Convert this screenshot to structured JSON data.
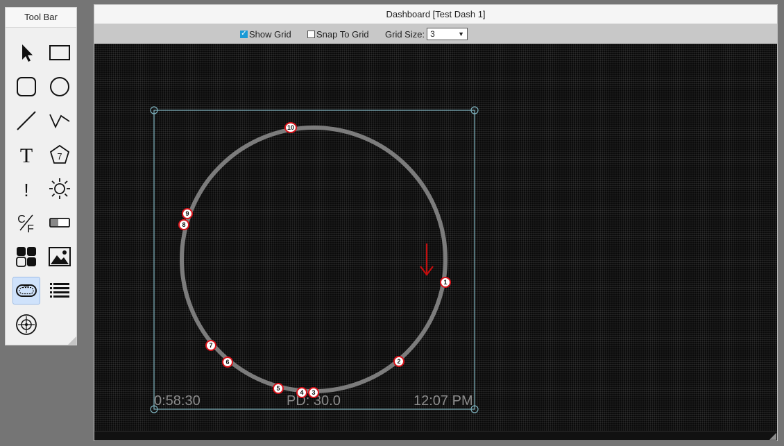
{
  "toolbar": {
    "title": "Tool Bar",
    "tools": [
      {
        "name": "pointer-tool"
      },
      {
        "name": "rectangle-tool"
      },
      {
        "name": "rounded-rect-tool"
      },
      {
        "name": "circle-tool"
      },
      {
        "name": "line-tool"
      },
      {
        "name": "polyline-tool"
      },
      {
        "name": "text-tool",
        "glyph": "T"
      },
      {
        "name": "badge-tool",
        "glyph": "7"
      },
      {
        "name": "alert-tool",
        "glyph": "!"
      },
      {
        "name": "sun-tool"
      },
      {
        "name": "temperature-unit-tool",
        "glyph_c": "C",
        "glyph_f": "F"
      },
      {
        "name": "toggle-tool"
      },
      {
        "name": "tiles-tool"
      },
      {
        "name": "image-tool"
      },
      {
        "name": "track-tool",
        "active": true
      },
      {
        "name": "list-tool"
      },
      {
        "name": "target-tool"
      }
    ]
  },
  "dashboard": {
    "title": "Dashboard [Test Dash 1]",
    "show_grid_label": "Show Grid",
    "show_grid_checked": true,
    "snap_label": "Snap To Grid",
    "snap_checked": false,
    "grid_size_label": "Grid Size:",
    "grid_size_value": "3",
    "canvas": {
      "elapsed": "0:58:30",
      "pd": "PD: 30.0",
      "clock": "12:07 PM",
      "markers": [
        "1",
        "2",
        "3",
        "4",
        "5",
        "6",
        "7",
        "8",
        "9",
        "10"
      ]
    }
  },
  "colors": {
    "track": "#7c7c7c",
    "marker_border": "#d8131a",
    "selection": "#7fb3bf",
    "arrow": "#c40d0d"
  }
}
